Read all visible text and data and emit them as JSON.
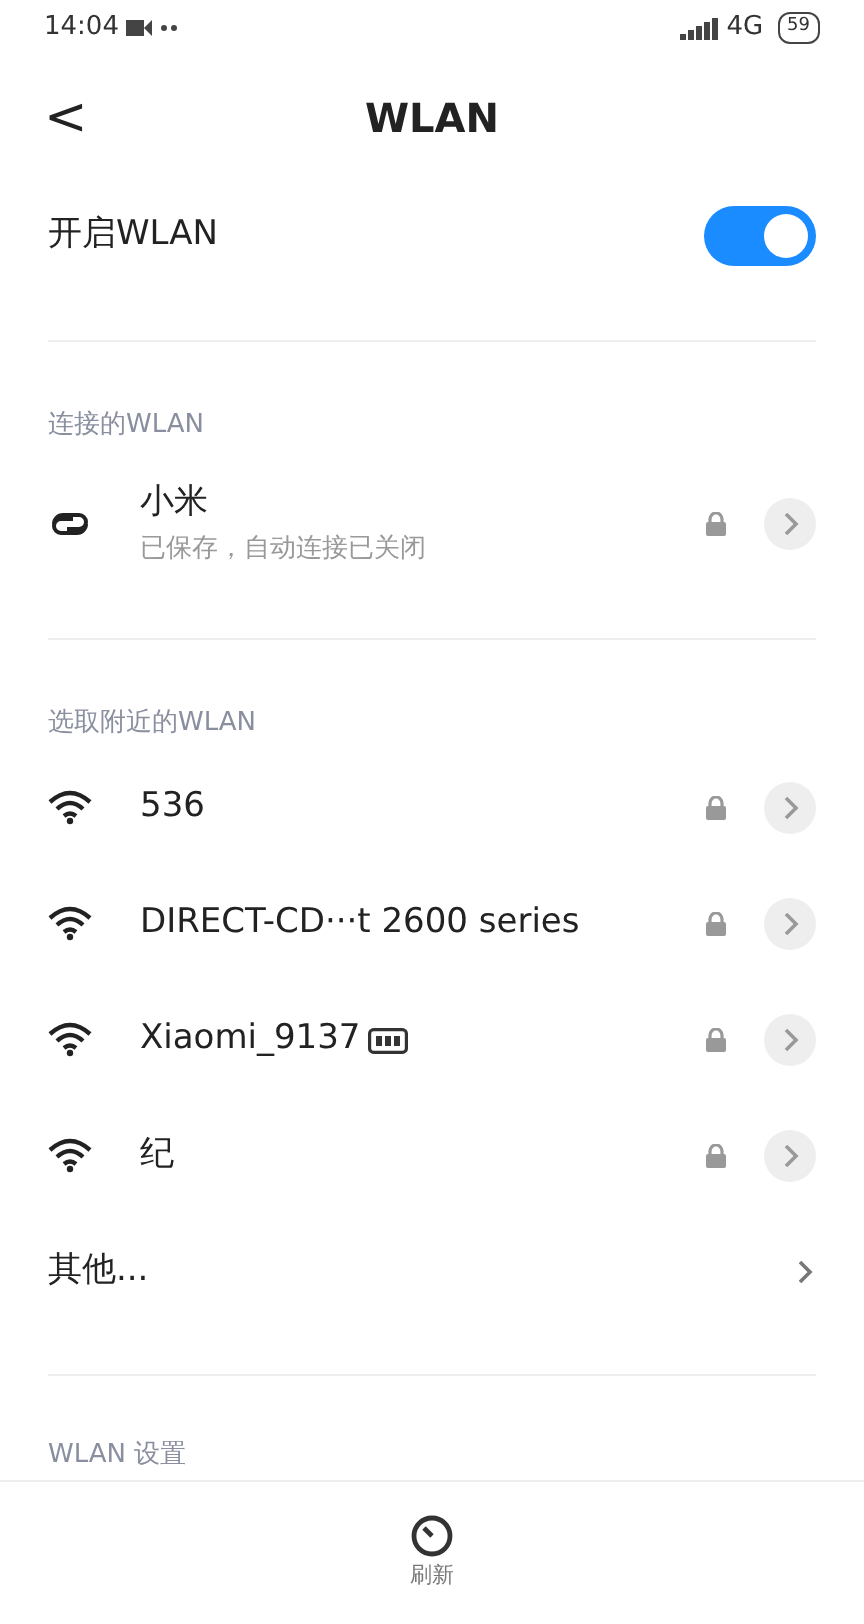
{
  "status_bar": {
    "time": "14:04",
    "network": "4G",
    "battery": "59"
  },
  "header": {
    "back": "<",
    "title": "WLAN"
  },
  "wlan_toggle": {
    "label": "开启WLAN",
    "on": true
  },
  "connected": {
    "heading": "连接的WLAN",
    "items": [
      {
        "kind": "saved",
        "name": "小米",
        "detail": "已保存，自动连接已关闭",
        "locked": true
      }
    ]
  },
  "nearby": {
    "heading": "选取附近的WLAN",
    "items": [
      {
        "kind": "wifi",
        "name": "536",
        "locked": true,
        "router_badge": false
      },
      {
        "kind": "wifi",
        "name": "DIRECT-CD···t 2600 series",
        "locked": true,
        "router_badge": false
      },
      {
        "kind": "wifi",
        "name": "Xiaomi_9137",
        "locked": true,
        "router_badge": true
      },
      {
        "kind": "wifi",
        "name": "纪",
        "locked": true,
        "router_badge": false
      },
      {
        "kind": "other",
        "name": "其他..."
      }
    ]
  },
  "settings_heading": "WLAN 设置",
  "bottom_bar": {
    "refresh_label": "刷新"
  }
}
